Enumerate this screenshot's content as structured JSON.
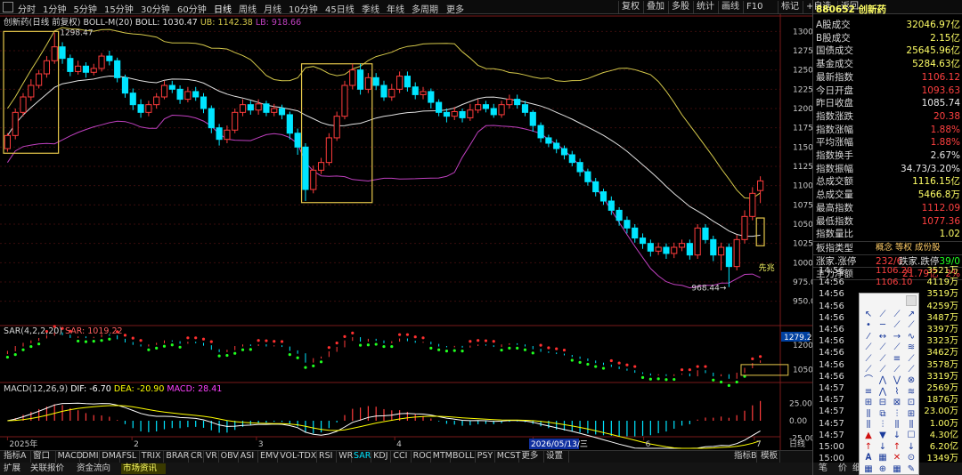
{
  "toolbar": {
    "periods": [
      "分时",
      "1分钟",
      "5分钟",
      "15分钟",
      "30分钟",
      "60分钟",
      "日线",
      "周线",
      "月线",
      "10分钟",
      "45日线",
      "季线",
      "年线",
      "多周期",
      "更多"
    ],
    "active_period": "日线",
    "right_buttons": [
      "复权",
      "叠加",
      "多股",
      "统计",
      "画线",
      "F10",
      "标记",
      "+自选",
      "返回"
    ]
  },
  "chart_header": {
    "title": "创新药(日线 前复权)",
    "indicator": "BOLL-M(20)",
    "boll_label": "BOLL: 1030.47",
    "ub_label": "UB: 1142.38",
    "lb_label": "LB: 918.66"
  },
  "annotations": {
    "high_label": "1298.47",
    "low_label": "968.44",
    "signal_label": "先兆"
  },
  "colors": {
    "up": "#ff3c3c",
    "down": "#00e5ff",
    "ub": "#d4c84a",
    "mid": "#e0e0e0",
    "lb": "#c040c0",
    "box": "#e6c74a",
    "sar_up": "#ff3030",
    "sar_down": "#20ff20",
    "dif": "#ffffff",
    "dea": "#ffff00",
    "grid": "#3a0d0d"
  },
  "price_axis": [
    "1300",
    "1275",
    "1250",
    "1225",
    "1200",
    "1175",
    "1150",
    "1125",
    "1100",
    "1075",
    "1050",
    "1025",
    "1000",
    "975.0",
    "950.0"
  ],
  "sar_panel": {
    "title": "SAR(4,2,2,20)",
    "value": "SAR: 1019.22",
    "axis": [
      "1200",
      "1050"
    ],
    "marker": "1279.2"
  },
  "macd_panel": {
    "title": "MACD(12,26,9)",
    "dif": "DIF: -6.70",
    "dea": "DEA: -20.90",
    "macd": "MACD: 28.41",
    "axis": [
      "25.00",
      "0.00",
      "-25.00"
    ]
  },
  "x_axis": {
    "labels": [
      "2025年",
      "2",
      "3",
      "4",
      "5",
      "6",
      "7"
    ],
    "cursor_date": "2026/05/13/三",
    "unit": "日线"
  },
  "indicator_tabs": [
    "指标A",
    "窗口",
    "MACD",
    "DMI",
    "DMA",
    "FSL",
    "TRIX",
    "BRAR",
    "CR",
    "VR",
    "OBV",
    "ASI",
    "EMV",
    "VOL-TDX",
    "RSI",
    "WR",
    "SAR",
    "KDJ",
    "CCI",
    "ROC",
    "MTM",
    "BOLL",
    "PSY",
    "MCST",
    "更多",
    "设置"
  ],
  "active_indicator": "SAR",
  "bottom_right": [
    "指标B",
    "模板"
  ],
  "bottom_tabs": [
    "扩展",
    "关联报价",
    "资金流向",
    "市场资讯"
  ],
  "quote_panel": {
    "code": "880652",
    "name": "创新药",
    "rows": [
      {
        "label": "A股成交",
        "value": "32046.97亿",
        "color": "#ffff66"
      },
      {
        "label": "B股成交",
        "value": "2.15亿",
        "color": "#ffff66"
      },
      {
        "label": "国债成交",
        "value": "25645.96亿",
        "color": "#ffff66"
      },
      {
        "label": "基金成交",
        "value": "5284.63亿",
        "color": "#ffff66"
      },
      {
        "label": "最新指数",
        "value": "1106.12",
        "color": "#ff4040"
      },
      {
        "label": "今日开盘",
        "value": "1093.63",
        "color": "#ff4040"
      },
      {
        "label": "昨日收盘",
        "value": "1085.74",
        "color": "#e8e8e8"
      },
      {
        "label": "指数涨跌",
        "value": "20.38",
        "color": "#ff4040"
      },
      {
        "label": "指数涨幅",
        "value": "1.88%",
        "color": "#ff4040"
      },
      {
        "label": "平均涨幅",
        "value": "1.88%",
        "color": "#ff4040"
      },
      {
        "label": "指数换手",
        "value": "2.67%",
        "color": "#e8e8e8"
      },
      {
        "label": "指数振幅",
        "value": "34.73/3.20%",
        "color": "#e8e8e8"
      },
      {
        "label": "总成交额",
        "value": "1116.15亿",
        "color": "#ffff66"
      },
      {
        "label": "总成交量",
        "value": "5466.8万",
        "color": "#ffff66"
      },
      {
        "label": "最高指数",
        "value": "1112.09",
        "color": "#ff4040"
      },
      {
        "label": "最低指数",
        "value": "1077.36",
        "color": "#ff4040"
      },
      {
        "label": "指数量比",
        "value": "1.02",
        "color": "#ffff66"
      }
    ],
    "sector_label": "板指类型",
    "sector_tabs": [
      "概念",
      "等权",
      "成份股"
    ],
    "rise_label": "涨家.涨停",
    "rise_value": "232/6",
    "fall_label": "跌家.跌停",
    "fall_value": "39/0",
    "flow_label": "主力净额",
    "flow_value": "21.79亿",
    "flow_pct": "2%"
  },
  "ticks": [
    {
      "time": "14:56",
      "price": "1106.20",
      "vol": "3521万"
    },
    {
      "time": "14:56",
      "price": "1106.10",
      "vol": "4119万"
    },
    {
      "time": "14:56",
      "price": "",
      "vol": "3519万"
    },
    {
      "time": "14:56",
      "price": "",
      "vol": "4259万"
    },
    {
      "time": "14:56",
      "price": "",
      "vol": "3487万"
    },
    {
      "time": "14:56",
      "price": "",
      "vol": "3397万"
    },
    {
      "time": "14:56",
      "price": "",
      "vol": "3323万"
    },
    {
      "time": "14:56",
      "price": "",
      "vol": "3462万"
    },
    {
      "time": "14:56",
      "price": "",
      "vol": "3578万"
    },
    {
      "time": "14:56",
      "price": "",
      "vol": "3319万"
    },
    {
      "time": "14:57",
      "price": "",
      "vol": "2569万"
    },
    {
      "time": "14:57",
      "price": "",
      "vol": "1876万"
    },
    {
      "time": "14:57",
      "price": "",
      "vol": "23.00万"
    },
    {
      "time": "14:57",
      "price": "",
      "vol": "1.00万"
    },
    {
      "time": "14:57",
      "price": "",
      "vol": "4.30亿"
    },
    {
      "time": "15:00",
      "price": "",
      "vol": "6.20亿"
    },
    {
      "time": "15:00",
      "price": "",
      "vol": "1349万"
    }
  ],
  "side_tabs": [
    "笔",
    "价",
    "细"
  ],
  "candles": [
    {
      "o": 1148,
      "c": 1165,
      "h": 1168,
      "l": 1144
    },
    {
      "o": 1165,
      "c": 1195,
      "h": 1200,
      "l": 1160
    },
    {
      "o": 1195,
      "c": 1215,
      "h": 1220,
      "l": 1190
    },
    {
      "o": 1215,
      "c": 1230,
      "h": 1238,
      "l": 1210
    },
    {
      "o": 1230,
      "c": 1245,
      "h": 1250,
      "l": 1226
    },
    {
      "o": 1245,
      "c": 1262,
      "h": 1268,
      "l": 1240
    },
    {
      "o": 1262,
      "c": 1280,
      "h": 1298.47,
      "l": 1258
    },
    {
      "o": 1280,
      "c": 1265,
      "h": 1286,
      "l": 1258
    },
    {
      "o": 1265,
      "c": 1248,
      "h": 1270,
      "l": 1242
    },
    {
      "o": 1248,
      "c": 1255,
      "h": 1262,
      "l": 1244
    },
    {
      "o": 1255,
      "c": 1247,
      "h": 1260,
      "l": 1240
    },
    {
      "o": 1247,
      "c": 1252,
      "h": 1258,
      "l": 1243
    },
    {
      "o": 1252,
      "c": 1268,
      "h": 1272,
      "l": 1248
    },
    {
      "o": 1268,
      "c": 1262,
      "h": 1275,
      "l": 1256
    },
    {
      "o": 1262,
      "c": 1240,
      "h": 1266,
      "l": 1234
    },
    {
      "o": 1240,
      "c": 1220,
      "h": 1244,
      "l": 1214
    },
    {
      "o": 1220,
      "c": 1205,
      "h": 1226,
      "l": 1198
    },
    {
      "o": 1205,
      "c": 1195,
      "h": 1212,
      "l": 1188
    },
    {
      "o": 1195,
      "c": 1205,
      "h": 1210,
      "l": 1190
    },
    {
      "o": 1205,
      "c": 1215,
      "h": 1220,
      "l": 1200
    },
    {
      "o": 1215,
      "c": 1230,
      "h": 1236,
      "l": 1212
    },
    {
      "o": 1230,
      "c": 1225,
      "h": 1236,
      "l": 1220
    },
    {
      "o": 1225,
      "c": 1212,
      "h": 1230,
      "l": 1206
    },
    {
      "o": 1212,
      "c": 1222,
      "h": 1228,
      "l": 1208
    },
    {
      "o": 1222,
      "c": 1215,
      "h": 1228,
      "l": 1210
    },
    {
      "o": 1215,
      "c": 1200,
      "h": 1220,
      "l": 1194
    },
    {
      "o": 1200,
      "c": 1175,
      "h": 1204,
      "l": 1168
    },
    {
      "o": 1175,
      "c": 1160,
      "h": 1180,
      "l": 1152
    },
    {
      "o": 1160,
      "c": 1172,
      "h": 1178,
      "l": 1155
    },
    {
      "o": 1172,
      "c": 1195,
      "h": 1200,
      "l": 1168
    },
    {
      "o": 1195,
      "c": 1205,
      "h": 1212,
      "l": 1190
    },
    {
      "o": 1205,
      "c": 1198,
      "h": 1210,
      "l": 1192
    },
    {
      "o": 1198,
      "c": 1206,
      "h": 1212,
      "l": 1192
    },
    {
      "o": 1206,
      "c": 1195,
      "h": 1210,
      "l": 1190
    },
    {
      "o": 1195,
      "c": 1200,
      "h": 1206,
      "l": 1190
    },
    {
      "o": 1200,
      "c": 1192,
      "h": 1205,
      "l": 1186
    },
    {
      "o": 1192,
      "c": 1168,
      "h": 1196,
      "l": 1160
    },
    {
      "o": 1168,
      "c": 1150,
      "h": 1174,
      "l": 1140
    },
    {
      "o": 1150,
      "c": 1095,
      "h": 1155,
      "l": 1080
    },
    {
      "o": 1095,
      "c": 1120,
      "h": 1126,
      "l": 1090
    },
    {
      "o": 1120,
      "c": 1130,
      "h": 1136,
      "l": 1115
    },
    {
      "o": 1130,
      "c": 1162,
      "h": 1168,
      "l": 1126
    },
    {
      "o": 1162,
      "c": 1190,
      "h": 1196,
      "l": 1158
    },
    {
      "o": 1190,
      "c": 1230,
      "h": 1236,
      "l": 1186
    },
    {
      "o": 1230,
      "c": 1250,
      "h": 1258,
      "l": 1225
    },
    {
      "o": 1250,
      "c": 1225,
      "h": 1258,
      "l": 1218
    },
    {
      "o": 1225,
      "c": 1240,
      "h": 1246,
      "l": 1220
    },
    {
      "o": 1240,
      "c": 1230,
      "h": 1246,
      "l": 1224
    },
    {
      "o": 1230,
      "c": 1215,
      "h": 1236,
      "l": 1210
    },
    {
      "o": 1215,
      "c": 1225,
      "h": 1232,
      "l": 1210
    },
    {
      "o": 1225,
      "c": 1242,
      "h": 1248,
      "l": 1220
    },
    {
      "o": 1242,
      "c": 1228,
      "h": 1248,
      "l": 1222
    },
    {
      "o": 1228,
      "c": 1218,
      "h": 1234,
      "l": 1212
    },
    {
      "o": 1218,
      "c": 1222,
      "h": 1228,
      "l": 1212
    },
    {
      "o": 1222,
      "c": 1208,
      "h": 1226,
      "l": 1200
    },
    {
      "o": 1208,
      "c": 1195,
      "h": 1212,
      "l": 1190
    },
    {
      "o": 1195,
      "c": 1190,
      "h": 1200,
      "l": 1182
    },
    {
      "o": 1190,
      "c": 1196,
      "h": 1202,
      "l": 1185
    },
    {
      "o": 1196,
      "c": 1188,
      "h": 1200,
      "l": 1182
    },
    {
      "o": 1188,
      "c": 1198,
      "h": 1206,
      "l": 1184
    },
    {
      "o": 1198,
      "c": 1205,
      "h": 1212,
      "l": 1194
    },
    {
      "o": 1205,
      "c": 1200,
      "h": 1210,
      "l": 1195
    },
    {
      "o": 1200,
      "c": 1192,
      "h": 1206,
      "l": 1188
    },
    {
      "o": 1192,
      "c": 1205,
      "h": 1210,
      "l": 1188
    },
    {
      "o": 1205,
      "c": 1212,
      "h": 1218,
      "l": 1200
    },
    {
      "o": 1212,
      "c": 1205,
      "h": 1218,
      "l": 1200
    },
    {
      "o": 1205,
      "c": 1195,
      "h": 1210,
      "l": 1190
    },
    {
      "o": 1195,
      "c": 1178,
      "h": 1198,
      "l": 1170
    },
    {
      "o": 1178,
      "c": 1162,
      "h": 1182,
      "l": 1156
    },
    {
      "o": 1162,
      "c": 1155,
      "h": 1166,
      "l": 1150
    },
    {
      "o": 1155,
      "c": 1148,
      "h": 1160,
      "l": 1142
    },
    {
      "o": 1148,
      "c": 1140,
      "h": 1152,
      "l": 1134
    },
    {
      "o": 1140,
      "c": 1130,
      "h": 1145,
      "l": 1125
    },
    {
      "o": 1130,
      "c": 1118,
      "h": 1135,
      "l": 1112
    },
    {
      "o": 1118,
      "c": 1105,
      "h": 1122,
      "l": 1100
    },
    {
      "o": 1105,
      "c": 1092,
      "h": 1110,
      "l": 1086
    },
    {
      "o": 1092,
      "c": 1080,
      "h": 1096,
      "l": 1075
    },
    {
      "o": 1080,
      "c": 1068,
      "h": 1086,
      "l": 1062
    },
    {
      "o": 1068,
      "c": 1055,
      "h": 1072,
      "l": 1048
    },
    {
      "o": 1055,
      "c": 1045,
      "h": 1060,
      "l": 1038
    },
    {
      "o": 1045,
      "c": 1032,
      "h": 1050,
      "l": 1026
    },
    {
      "o": 1032,
      "c": 1025,
      "h": 1038,
      "l": 1018
    },
    {
      "o": 1025,
      "c": 1015,
      "h": 1030,
      "l": 1008
    },
    {
      "o": 1015,
      "c": 1020,
      "h": 1026,
      "l": 1010
    },
    {
      "o": 1020,
      "c": 1012,
      "h": 1025,
      "l": 1005
    },
    {
      "o": 1012,
      "c": 1020,
      "h": 1026,
      "l": 1006
    },
    {
      "o": 1020,
      "c": 1025,
      "h": 1030,
      "l": 1015
    },
    {
      "o": 1025,
      "c": 1010,
      "h": 1030,
      "l": 1004
    },
    {
      "o": 1010,
      "c": 1045,
      "h": 1050,
      "l": 1005
    },
    {
      "o": 1045,
      "c": 1030,
      "h": 1050,
      "l": 1025
    },
    {
      "o": 1030,
      "c": 1010,
      "h": 1035,
      "l": 1002
    },
    {
      "o": 1010,
      "c": 1020,
      "h": 1026,
      "l": 990
    },
    {
      "o": 1020,
      "c": 995,
      "h": 1025,
      "l": 968.44
    },
    {
      "o": 995,
      "c": 1030,
      "h": 1036,
      "l": 990
    },
    {
      "o": 1030,
      "c": 1060,
      "h": 1068,
      "l": 1025
    },
    {
      "o": 1060,
      "c": 1090,
      "h": 1098,
      "l": 1055
    },
    {
      "o": 1093.63,
      "c": 1106.12,
      "h": 1112.09,
      "l": 1077.36
    }
  ]
}
